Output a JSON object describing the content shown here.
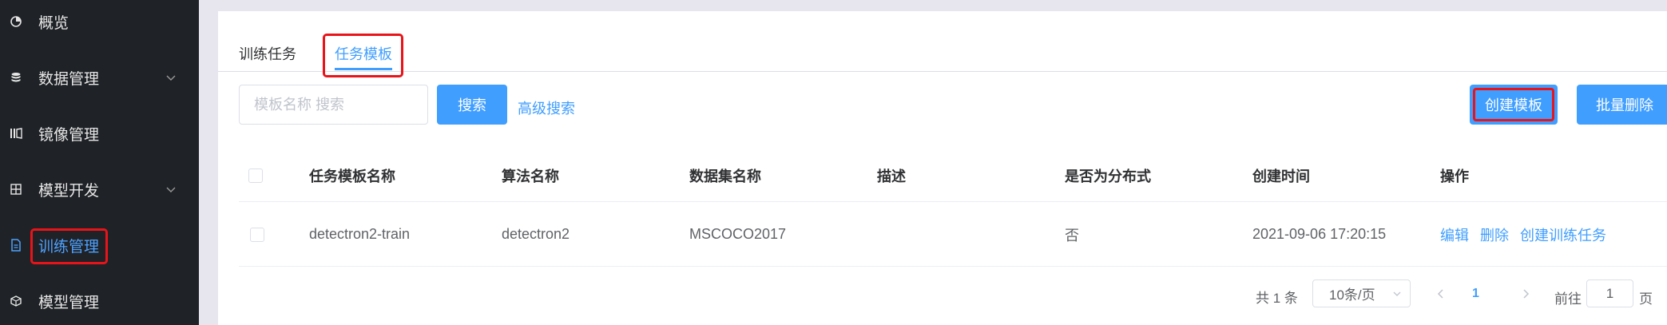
{
  "sidebar": {
    "items": [
      {
        "label": "概览",
        "icon": "pie-chart-icon"
      },
      {
        "label": "数据管理",
        "icon": "database-icon",
        "has_children": true
      },
      {
        "label": "镜像管理",
        "icon": "mirror-icon"
      },
      {
        "label": "模型开发",
        "icon": "grid-icon",
        "has_children": true
      },
      {
        "label": "训练管理",
        "icon": "document-icon",
        "active": true
      },
      {
        "label": "模型管理",
        "icon": "cube-icon"
      }
    ]
  },
  "tabs": [
    {
      "label": "训练任务"
    },
    {
      "label": "任务模板",
      "active": true
    }
  ],
  "toolbar": {
    "search_placeholder": "模板名称 搜索",
    "search_label": "搜索",
    "advanced_label": "高级搜索",
    "create_label": "创建模板",
    "batch_delete_label": "批量删除"
  },
  "table": {
    "columns": [
      "任务模板名称",
      "算法名称",
      "数据集名称",
      "描述",
      "是否为分布式",
      "创建时间",
      "操作"
    ],
    "rows": [
      {
        "name": "detectron2-train",
        "algorithm": "detectron2",
        "dataset": "MSCOCO2017",
        "description": "",
        "distributed": "否",
        "created": "2021-09-06 17:20:15",
        "actions": [
          "编辑",
          "删除",
          "创建训练任务"
        ]
      }
    ]
  },
  "pagination": {
    "total_text": "共 1 条",
    "page_size": "10条/页",
    "current_page": "1",
    "goto_label": "前往",
    "goto_value": "1",
    "page_suffix": "页"
  },
  "colors": {
    "sidebar_bg": "#1f2226",
    "accent": "#409eff",
    "highlight": "#e8141a"
  }
}
